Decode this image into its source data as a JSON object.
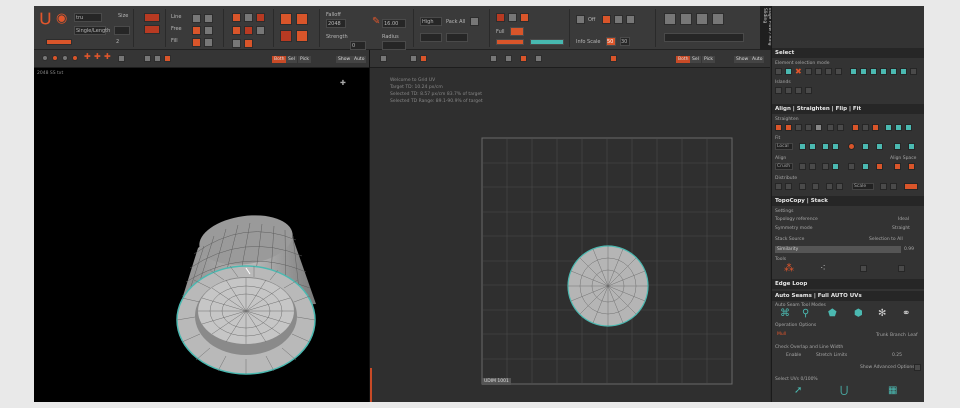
{
  "toolbar": {
    "brush_field": "tru",
    "brush_sub": "Single/Length",
    "brush_size_label": "Size",
    "brush_size_value": "2",
    "mode_line": "Line",
    "mode_free": "Free",
    "mode_fill": "Fill",
    "dyn_value": "0",
    "falloff_label": "Falloff",
    "strength_value": "2048",
    "strength_label": "Strength",
    "radius_value": "16.00",
    "radius_label": "Radius",
    "quality_value": "High",
    "pack_label": "Pack All",
    "falloff_val": "Full",
    "toggle_off": "Off",
    "info_scale": "Info Scale",
    "pct_a": "50",
    "pct_b": "30"
  },
  "side_tab": {
    "label": "Edge Flow / Ring Sliding"
  },
  "left_viewport": {
    "subbar_buttons": [
      "Both",
      "Sel",
      "Pick",
      "Show",
      "Auto"
    ],
    "info": "2048 SS  txt"
  },
  "right_viewport": {
    "subbar_buttons": [
      "Both",
      "Sel",
      "Pick",
      "Show",
      "Auto"
    ],
    "info_lines": [
      "Welcome to Grid  UV",
      "Target TD: 10.24 px/cm",
      "Selected TD: 8.57 px/cm  83.7% of target",
      "Selected TD Range: 89.1-90.9% of target"
    ],
    "grid_label": "UDIM 1001"
  },
  "panel": {
    "select": {
      "title": "Select",
      "sub1": "Element selection mode",
      "sub2": "Islands"
    },
    "align": {
      "title": "Align | Straighten | Flip | Fit",
      "straighten_label": "Straighten",
      "fit_label": "Fit",
      "fit_mode": "Local",
      "align_label": "Align",
      "align_mode": "Crush",
      "distribute_label": "Distribute",
      "distribute_val": "Scale",
      "space_label": "Align Space"
    },
    "topocopy": {
      "title": "TopoCopy | Stack",
      "settings": "Settings",
      "topo_ref": "Topology reference",
      "topo_ref_val": "Ideal",
      "sym_mode": "Symmetry mode",
      "sym_mode_val": "Straight",
      "stack_source": "Stack Source",
      "stack_source_val": "Selection to All",
      "similarity": "Similarity",
      "similarity_val": "0.99",
      "tools_label": "Tools"
    },
    "edge_loop": {
      "title": "Edge Loop"
    },
    "auto_seams": {
      "title": "Auto Seams | Full AUTO UVs",
      "sub": "Auto Seam Tool Modes",
      "operation_label": "Operation Options",
      "op_val": "Mull",
      "trunk": "Trunk",
      "branch": "Branch",
      "leaf": "Leaf",
      "check_label": "Check Overlap and Line Width",
      "enable": "Enable",
      "stretch_label": "Stretch Limits",
      "stretch_val": "0.25",
      "show_adv": "Show Advanced Options",
      "bottom_label": "Select UVs 0/100%"
    }
  },
  "colors": {
    "accent": "#e0562c",
    "teal": "#4bb9b1"
  }
}
